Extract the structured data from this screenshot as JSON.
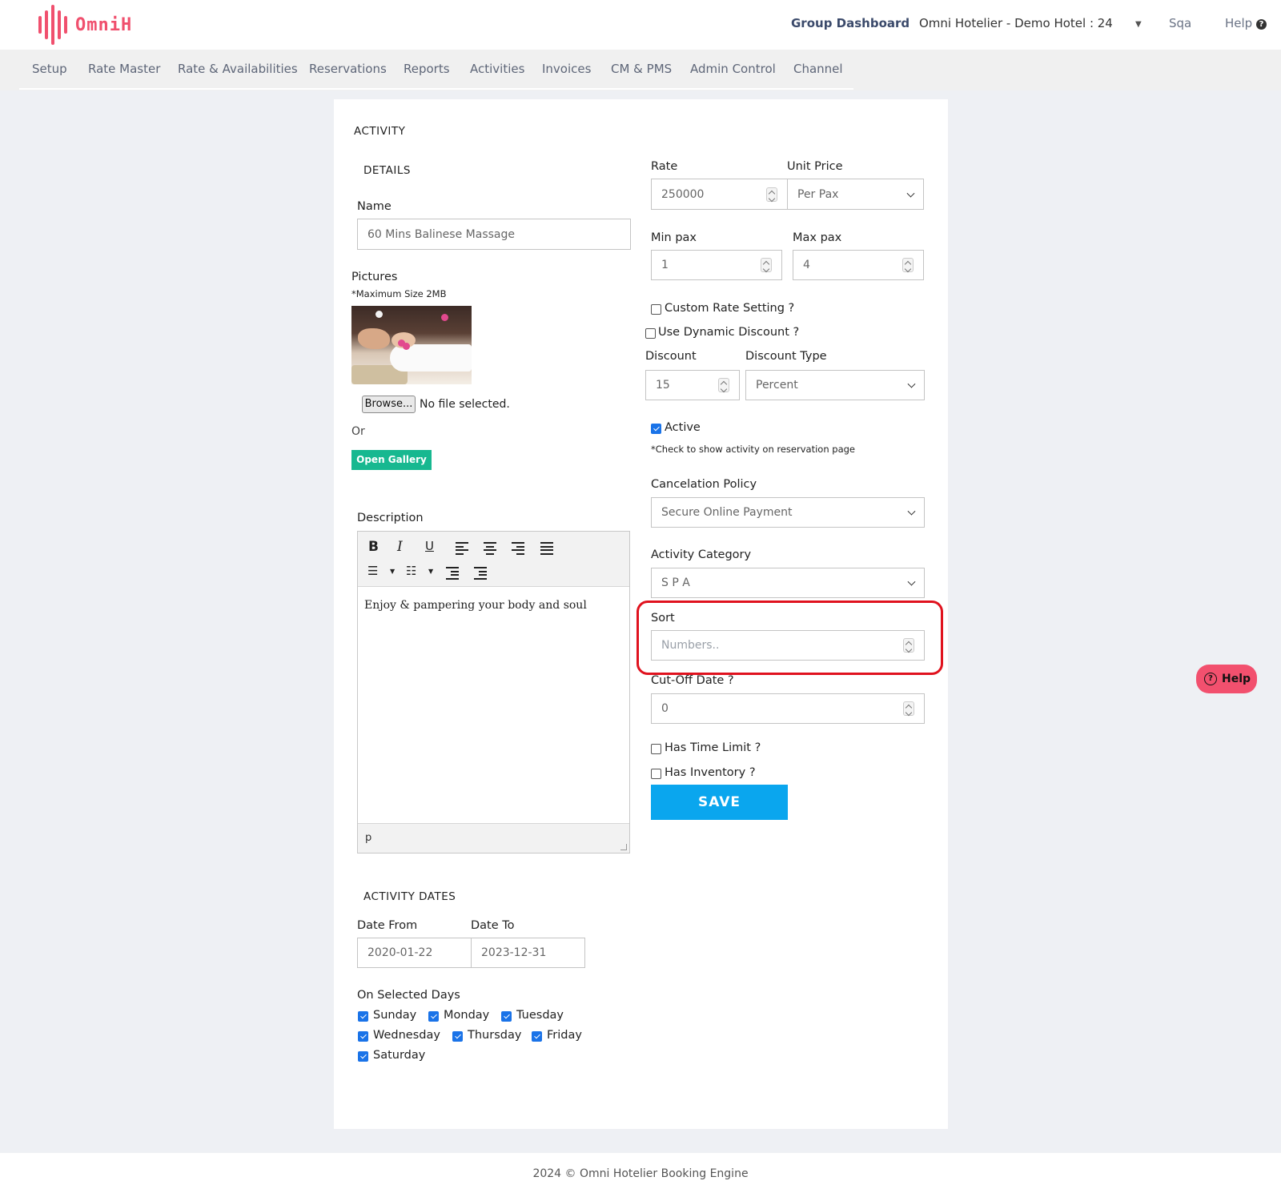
{
  "brand": {
    "name": "OmniH",
    "color": "#f0506e"
  },
  "header": {
    "group_dashboard": "Group Dashboard",
    "hotel_selector": "Omni Hotelier - Demo Hotel : 24",
    "user": "Sqa",
    "help": "Help"
  },
  "nav": [
    "Setup",
    "Rate Master",
    "Rate & Availabilities",
    "Reservations",
    "Reports",
    "Activities",
    "Invoices",
    "CM & PMS",
    "Admin Control",
    "Channel"
  ],
  "form": {
    "title": "ACTIVITY",
    "details_title": "DETAILS",
    "name_label": "Name",
    "name_value": "60 Mins Balinese Massage",
    "pictures_label": "Pictures",
    "max_size_note": "*Maximum Size 2MB",
    "browse_label": "Browse...",
    "no_file_text": "No file selected.",
    "or_text": "Or",
    "open_gallery": "Open Gallery",
    "description_label": "Description",
    "description_text": "Enjoy & pampering your body and soul",
    "editor_path": "p",
    "activity_dates_title": "ACTIVITY DATES",
    "date_from_label": "Date From",
    "date_from": "2020-01-22",
    "date_to_label": "Date To",
    "date_to": "2023-12-31",
    "selected_days_label": "On Selected Days",
    "days": [
      {
        "label": "Sunday",
        "checked": true
      },
      {
        "label": "Monday",
        "checked": true
      },
      {
        "label": "Tuesday",
        "checked": true
      },
      {
        "label": "Wednesday",
        "checked": true
      },
      {
        "label": "Thursday",
        "checked": true
      },
      {
        "label": "Friday",
        "checked": true
      },
      {
        "label": "Saturday",
        "checked": true
      }
    ],
    "rate_label": "Rate",
    "rate_value": "250000",
    "unit_price_label": "Unit Price",
    "unit_price_value": "Per Pax",
    "min_pax_label": "Min pax",
    "min_pax_value": "1",
    "max_pax_label": "Max pax",
    "max_pax_value": "4",
    "custom_rate_label": "Custom Rate Setting ?",
    "dynamic_discount_label": "Use Dynamic Discount ?",
    "discount_label": "Discount",
    "discount_value": "15",
    "discount_type_label": "Discount Type",
    "discount_type_value": "Percent",
    "active_label": "Active",
    "active_checked": true,
    "active_note": "*Check to show activity on reservation page",
    "cancel_policy_label": "Cancelation Policy",
    "cancel_policy_value": "Secure Online Payment",
    "category_label": "Activity Category",
    "category_value": "S P A",
    "sort_label": "Sort",
    "sort_placeholder": "Numbers..",
    "cutoff_label": "Cut-Off Date ?",
    "cutoff_value": "0",
    "time_limit_label": "Has Time Limit ?",
    "inventory_label": "Has Inventory ?",
    "save_label": "SAVE"
  },
  "help_widget": "Help",
  "footer": "2024 © Omni Hotelier Booking Engine",
  "colors": {
    "accent": "#0aa6ee",
    "gallery": "#17b890",
    "highlight": "#e0121e",
    "help_widget": "#f2506e"
  }
}
